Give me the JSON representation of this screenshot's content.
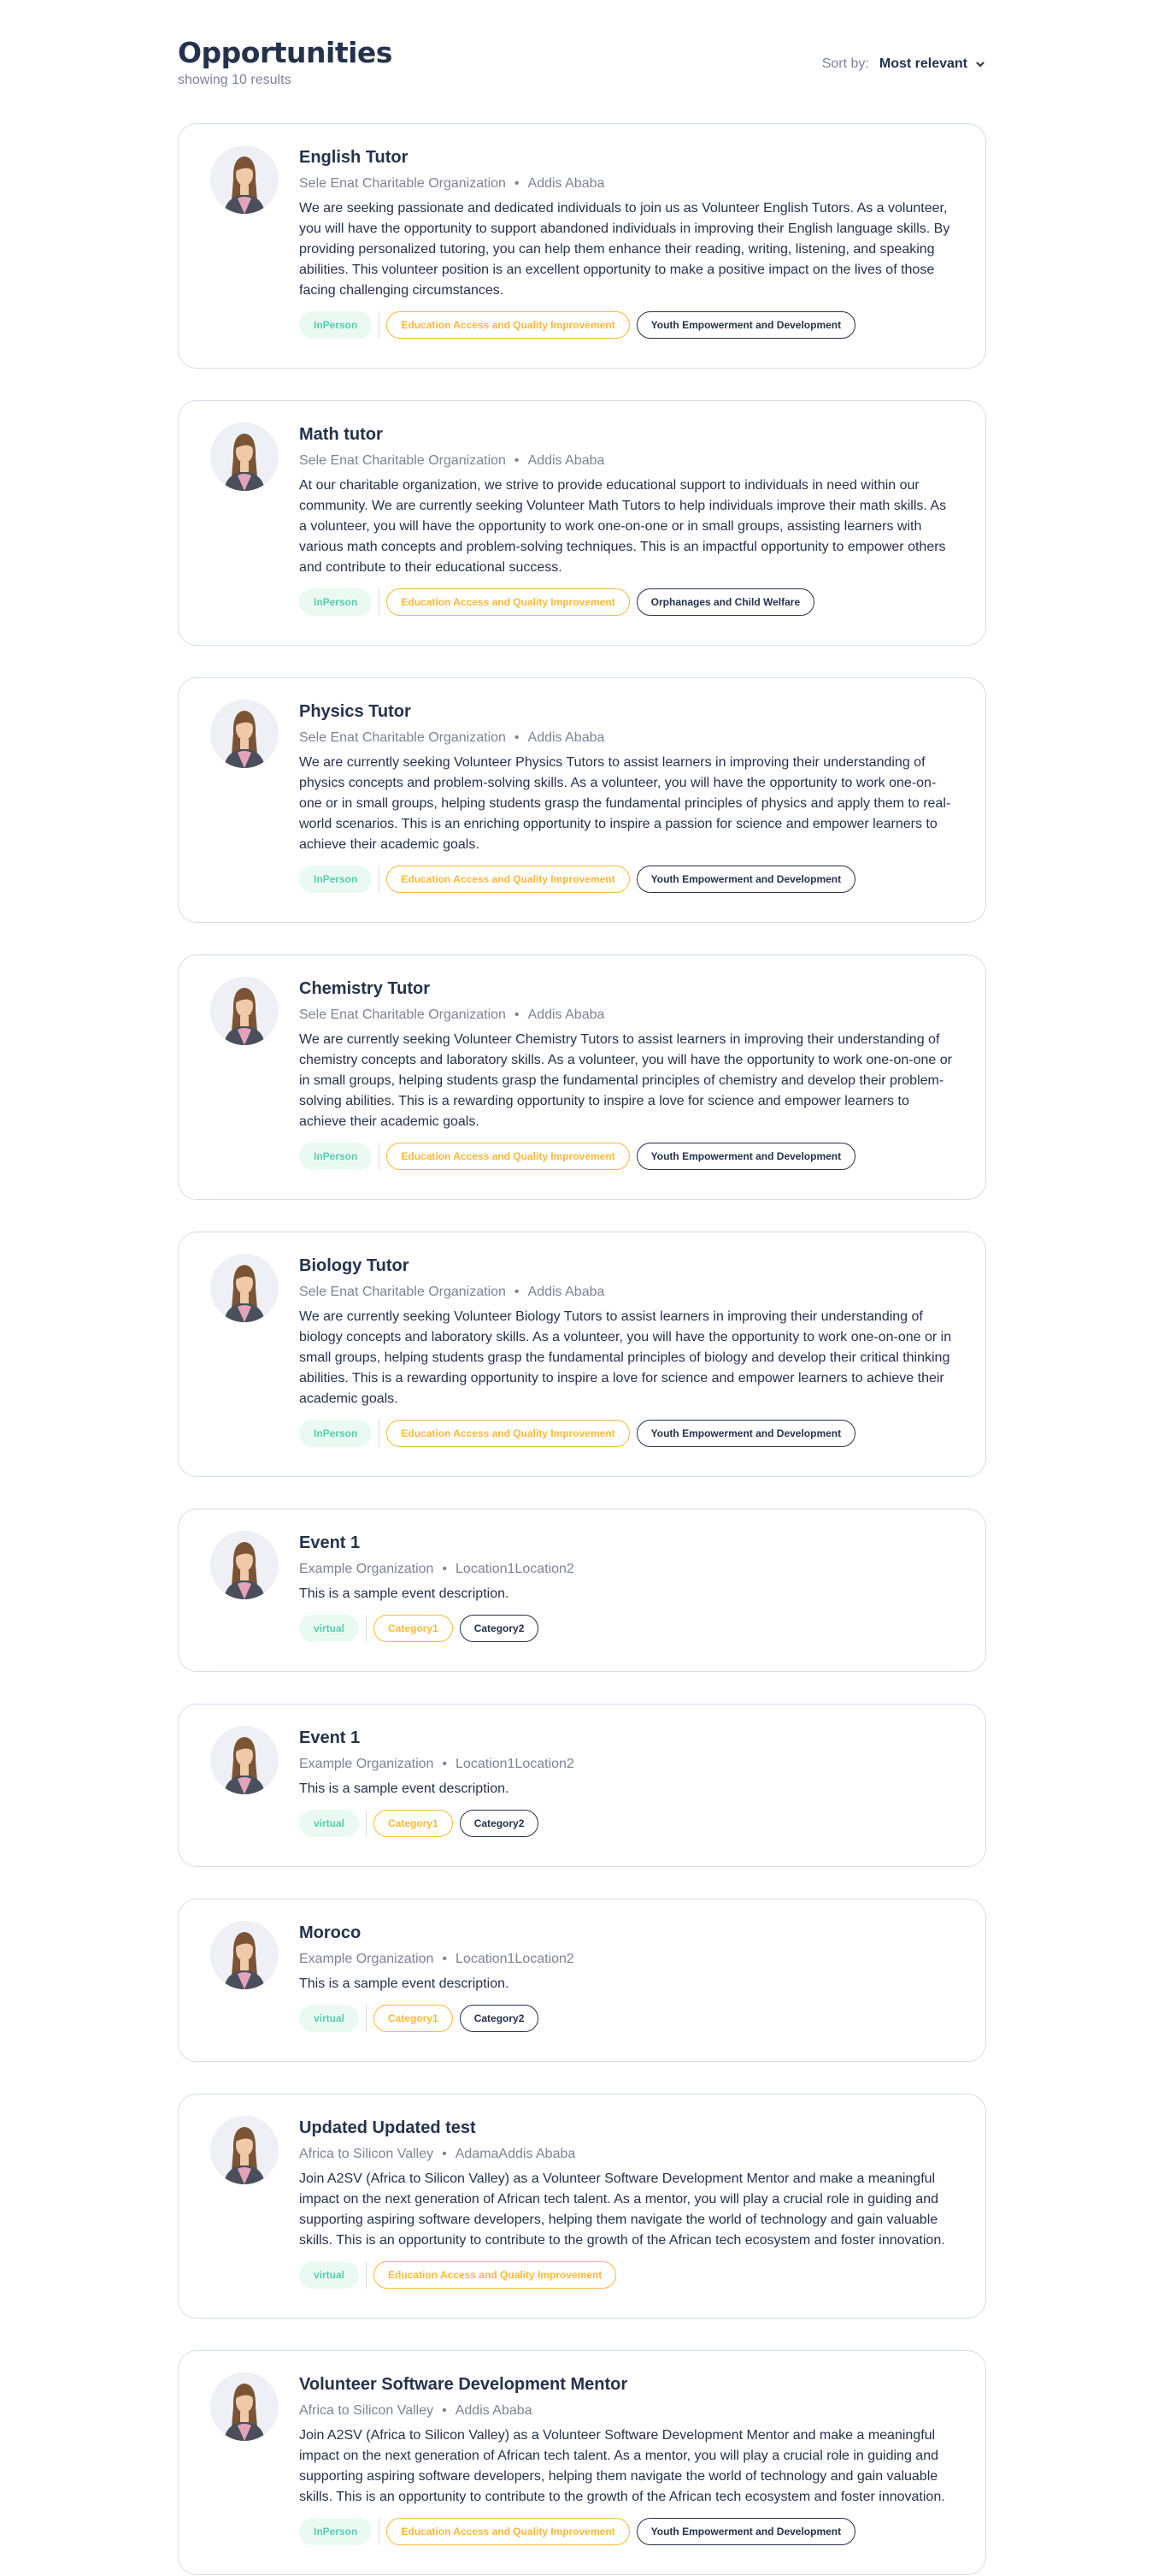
{
  "header": {
    "title": "Opportunities",
    "results": "showing 10 results",
    "sort_label": "Sort by:",
    "sort_value": "Most relevant"
  },
  "colors": {
    "primary_text": "#25324b",
    "muted_text": "#7c8493",
    "type_tag_text": "#56cdad",
    "type_tag_bg": "#eafaf3",
    "category_tag": "#ffb836",
    "border": "#d6ddeb"
  },
  "opportunities": [
    {
      "title": "English Tutor",
      "org": "Sele Enat Charitable Organization",
      "location": "Addis Ababa",
      "description": "We are seeking passionate and dedicated individuals to join us as Volunteer English Tutors. As a volunteer, you will have the opportunity to support abandoned individuals in improving their English language skills. By providing personalized tutoring, you can help them enhance their reading, writing, listening, and speaking abilities. This volunteer position is an excellent opportunity to make a positive impact on the lives of those facing challenging circumstances.",
      "type": "InPerson",
      "categories": [
        "Education Access and Quality Improvement",
        "Youth Empowerment and Development"
      ]
    },
    {
      "title": "Math tutor",
      "org": "Sele Enat Charitable Organization",
      "location": "Addis Ababa",
      "description": "At our charitable organization, we strive to provide educational support to individuals in need within our community. We are currently seeking Volunteer Math Tutors to help individuals improve their math skills. As a volunteer, you will have the opportunity to work one-on-one or in small groups, assisting learners with various math concepts and problem-solving techniques. This is an impactful opportunity to empower others and contribute to their educational success.",
      "type": "InPerson",
      "categories": [
        "Education Access and Quality Improvement",
        "Orphanages and Child Welfare"
      ]
    },
    {
      "title": "Physics Tutor",
      "org": "Sele Enat Charitable Organization",
      "location": "Addis Ababa",
      "description": "We are currently seeking Volunteer Physics Tutors to assist learners in improving their understanding of physics concepts and problem-solving skills. As a volunteer, you will have the opportunity to work one-on-one or in small groups, helping students grasp the fundamental principles of physics and apply them to real-world scenarios. This is an enriching opportunity to inspire a passion for science and empower learners to achieve their academic goals.",
      "type": "InPerson",
      "categories": [
        "Education Access and Quality Improvement",
        "Youth Empowerment and Development"
      ]
    },
    {
      "title": "Chemistry Tutor",
      "org": "Sele Enat Charitable Organization",
      "location": "Addis Ababa",
      "description": "We are currently seeking Volunteer Chemistry Tutors to assist learners in improving their understanding of chemistry concepts and laboratory skills. As a volunteer, you will have the opportunity to work one-on-one or in small groups, helping students grasp the fundamental principles of chemistry and develop their problem-solving abilities. This is a rewarding opportunity to inspire a love for science and empower learners to achieve their academic goals.",
      "type": "InPerson",
      "categories": [
        "Education Access and Quality Improvement",
        "Youth Empowerment and Development"
      ]
    },
    {
      "title": "Biology Tutor",
      "org": "Sele Enat Charitable Organization",
      "location": "Addis Ababa",
      "description": "We are currently seeking Volunteer Biology Tutors to assist learners in improving their understanding of biology concepts and laboratory skills. As a volunteer, you will have the opportunity to work one-on-one or in small groups, helping students grasp the fundamental principles of biology and develop their critical thinking abilities. This is a rewarding opportunity to inspire a love for science and empower learners to achieve their academic goals.",
      "type": "InPerson",
      "categories": [
        "Education Access and Quality Improvement",
        "Youth Empowerment and Development"
      ]
    },
    {
      "title": "Event 1",
      "org": "Example Organization",
      "location": "Location1Location2",
      "description": "This is a sample event description.",
      "type": "virtual",
      "categories": [
        "Category1",
        "Category2"
      ]
    },
    {
      "title": "Event 1",
      "org": "Example Organization",
      "location": "Location1Location2",
      "description": "This is a sample event description.",
      "type": "virtual",
      "categories": [
        "Category1",
        "Category2"
      ]
    },
    {
      "title": "Moroco",
      "org": "Example Organization",
      "location": "Location1Location2",
      "description": "This is a sample event description.",
      "type": "virtual",
      "categories": [
        "Category1",
        "Category2"
      ]
    },
    {
      "title": "Updated Updated test",
      "org": "Africa to Silicon Valley",
      "location": "AdamaAddis Ababa",
      "description": "Join A2SV (Africa to Silicon Valley) as a Volunteer Software Development Mentor and make a meaningful impact on the next generation of African tech talent. As a mentor, you will play a crucial role in guiding and supporting aspiring software developers, helping them navigate the world of technology and gain valuable skills. This is an opportunity to contribute to the growth of the African tech ecosystem and foster innovation.",
      "type": "virtual",
      "categories": [
        "Education Access and Quality Improvement"
      ]
    },
    {
      "title": "Volunteer Software Development Mentor",
      "org": "Africa to Silicon Valley",
      "location": "Addis Ababa",
      "description": "Join A2SV (Africa to Silicon Valley) as a Volunteer Software Development Mentor and make a meaningful impact on the next generation of African tech talent. As a mentor, you will play a crucial role in guiding and supporting aspiring software developers, helping them navigate the world of technology and gain valuable skills. This is an opportunity to contribute to the growth of the African tech ecosystem and foster innovation.",
      "type": "InPerson",
      "categories": [
        "Education Access and Quality Improvement",
        "Youth Empowerment and Development"
      ]
    }
  ]
}
